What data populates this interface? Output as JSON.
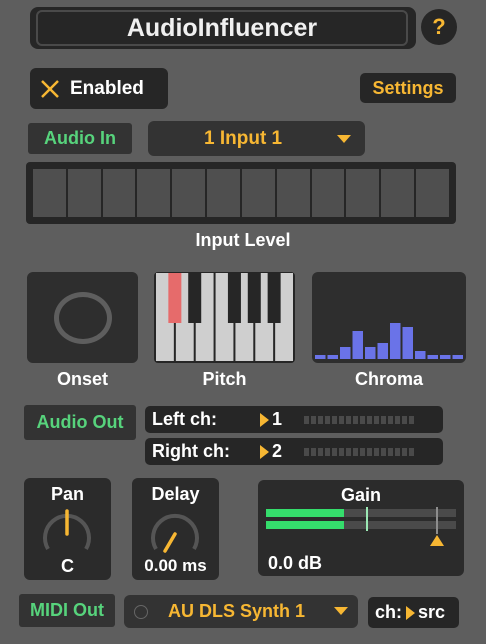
{
  "title": "AudioInfluencer",
  "help_label": "?",
  "enabled": {
    "icon": "x-icon",
    "label": "Enabled",
    "state": true
  },
  "settings_label": "Settings",
  "audio_in": {
    "tag": "Audio In",
    "selected": "1 Input 1"
  },
  "input_level": {
    "label": "Input Level",
    "cells": 12
  },
  "onset": {
    "label": "Onset"
  },
  "pitch": {
    "label": "Pitch",
    "active_key": "C#"
  },
  "chroma": {
    "label": "Chroma",
    "bars": [
      0.05,
      0.05,
      0.15,
      0.35,
      0.15,
      0.2,
      0.45,
      0.4,
      0.1,
      0.05,
      0.05,
      0.05
    ]
  },
  "audio_out": {
    "tag": "Audio Out",
    "left": {
      "label": "Left ch:",
      "value": "1"
    },
    "right": {
      "label": "Right ch:",
      "value": "2"
    }
  },
  "pan": {
    "label": "Pan",
    "value": "C"
  },
  "delay": {
    "label": "Delay",
    "value": "0.00 ms"
  },
  "gain": {
    "label": "Gain",
    "value": "0.0 dB",
    "level_top": 0.41,
    "level_bottom": 0.41
  },
  "midi_out": {
    "tag": "MIDI Out",
    "selected": "AU DLS Synth 1",
    "ch_label": "ch:",
    "ch_value": "src"
  },
  "colors": {
    "accent": "#f7b733",
    "green": "#57d37c",
    "meter_green": "#35dd6c",
    "pitch_active": "#e66b6b",
    "chroma_bar": "#6a73e8"
  }
}
